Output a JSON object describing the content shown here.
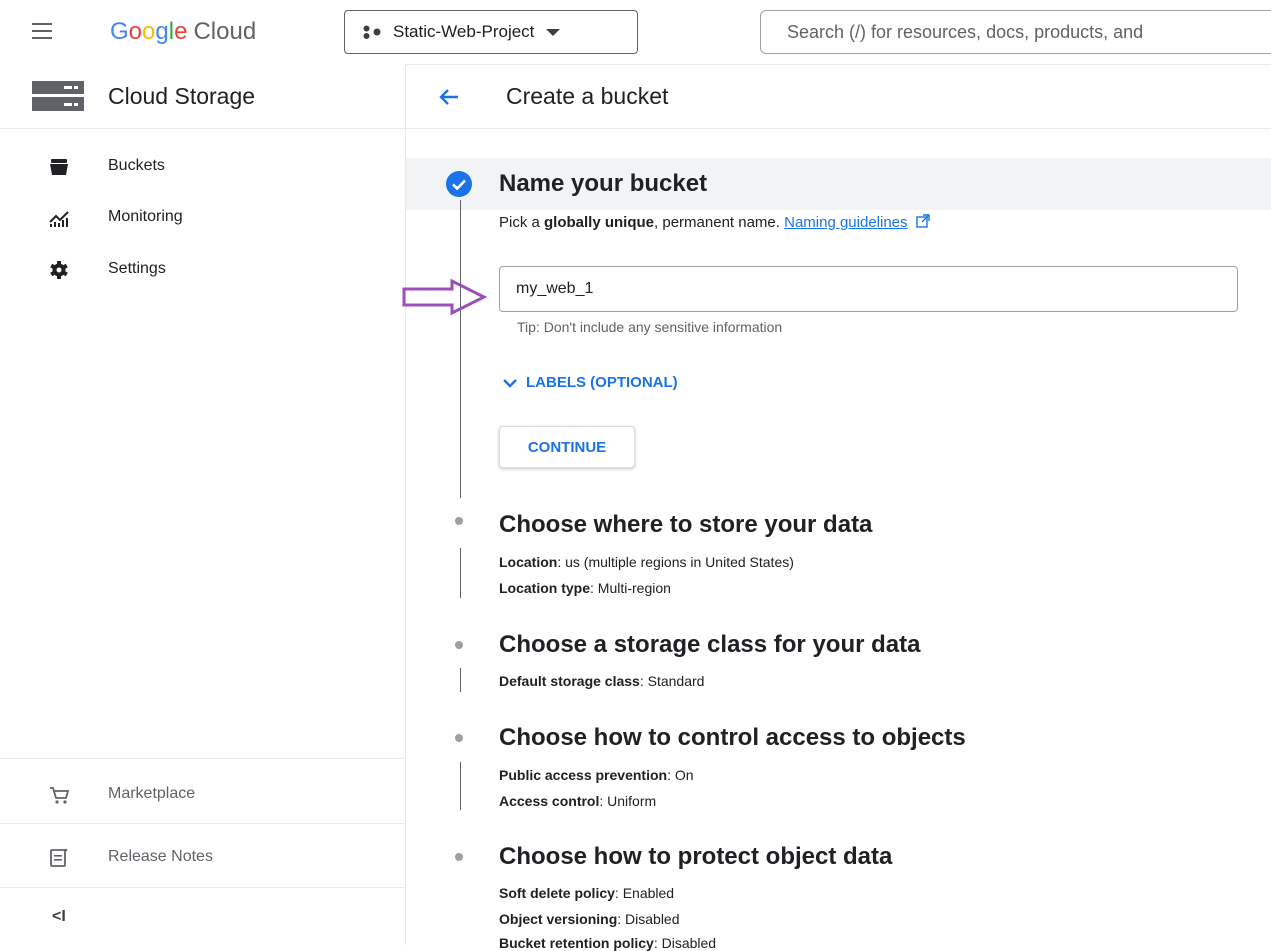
{
  "topbar": {
    "logo_google": [
      "G",
      "o",
      "o",
      "g",
      "l",
      "e"
    ],
    "logo_cloud": "Cloud",
    "project_name": "Static-Web-Project",
    "search_placeholder": "Search (/) for resources, docs, products, and"
  },
  "sidebar": {
    "title": "Cloud Storage",
    "items": [
      {
        "label": "Buckets",
        "icon": "bucket-icon"
      },
      {
        "label": "Monitoring",
        "icon": "chart-icon"
      },
      {
        "label": "Settings",
        "icon": "gear-icon"
      }
    ],
    "bottom_items": [
      {
        "label": "Marketplace",
        "icon": "cart-icon"
      },
      {
        "label": "Release Notes",
        "icon": "notes-icon"
      }
    ],
    "collapse_label": "<I"
  },
  "page": {
    "title": "Create a bucket"
  },
  "step1": {
    "title": "Name your bucket",
    "desc_pre": "Pick a ",
    "desc_bold": "globally unique",
    "desc_post": ", permanent name. ",
    "link": "Naming guidelines",
    "input_value": "my_web_1",
    "tip": "Tip: Don't include any sensitive information",
    "labels_toggle": "LABELS (OPTIONAL)",
    "continue": "CONTINUE"
  },
  "steps": [
    {
      "title": "Choose where to store your data",
      "details": [
        {
          "key": "Location",
          "value": ": us (multiple regions in United States)"
        },
        {
          "key": "Location type",
          "value": ": Multi-region"
        }
      ]
    },
    {
      "title": "Choose a storage class for your data",
      "details": [
        {
          "key": "Default storage class",
          "value": ": Standard"
        }
      ]
    },
    {
      "title": "Choose how to control access to objects",
      "details": [
        {
          "key": "Public access prevention",
          "value": ": On"
        },
        {
          "key": "Access control",
          "value": ": Uniform"
        }
      ]
    },
    {
      "title": "Choose how to protect object data",
      "details": [
        {
          "key": "Soft delete policy",
          "value": ": Enabled"
        },
        {
          "key": "Object versioning",
          "value": ": Disabled"
        },
        {
          "key": "Bucket retention policy",
          "value": ": Disabled"
        }
      ]
    }
  ],
  "colors": {
    "accent": "#1a73e8",
    "annotation_arrow": "#9b4fb8",
    "step_band": "#f1f3f4"
  }
}
